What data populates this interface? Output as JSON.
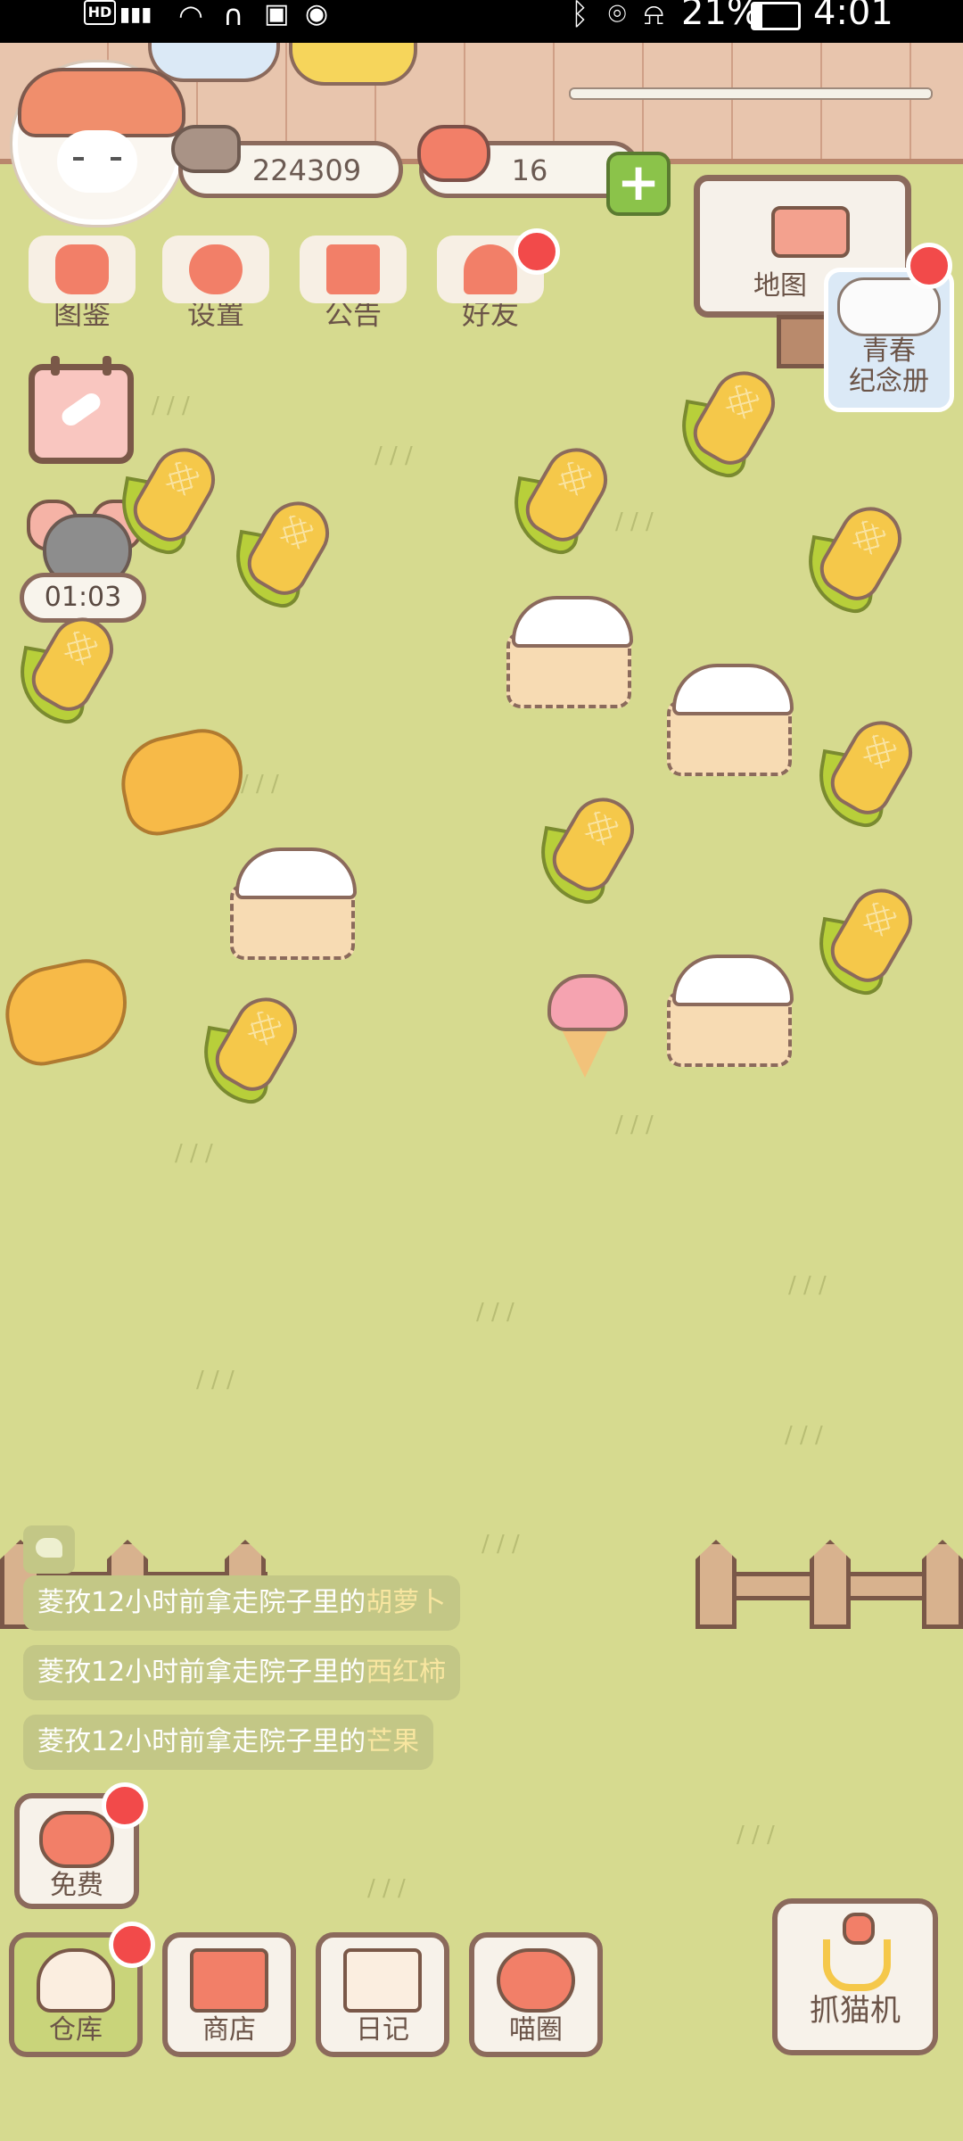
{
  "status_bar": {
    "network": "HD 4G",
    "battery": "21%",
    "time": "4:01",
    "icons": [
      "wifi-icon",
      "headphones-icon",
      "cast-icon",
      "location-icon",
      "bluetooth-icon",
      "mute-icon",
      "battery-icon"
    ]
  },
  "resources": {
    "fish": "224309",
    "hearts": "16"
  },
  "top_menu": [
    {
      "label": "图鉴",
      "icon": "cat-face-icon"
    },
    {
      "label": "设置",
      "icon": "gear-icon"
    },
    {
      "label": "公告",
      "icon": "gift-icon"
    },
    {
      "label": "好友",
      "icon": "friends-icon"
    }
  ],
  "map_label": "地图",
  "youth_book": {
    "line1": "青春",
    "line2": "纪念册"
  },
  "timer": "01:03",
  "chat": {
    "messages": [
      {
        "name": "菱孜",
        "text": "12小时前拿走院子里的",
        "item": "胡萝卜"
      },
      {
        "name": "菱孜",
        "text": "12小时前拿走院子里的",
        "item": "西红柿"
      },
      {
        "name": "菱孜",
        "text": "12小时前拿走院子里的",
        "item": "芒果"
      }
    ]
  },
  "free_label": "免费",
  "bottom_nav": [
    {
      "label": "仓库",
      "icon": "warehouse-icon"
    },
    {
      "label": "商店",
      "icon": "shop-icon"
    },
    {
      "label": "日记",
      "icon": "diary-icon"
    },
    {
      "label": "喵圈",
      "icon": "planet-cat-icon"
    }
  ],
  "claw_label": "抓猫机",
  "colors": {
    "grass": "#d6da8f",
    "accent": "#f27f68",
    "badge": "#f24a4a",
    "wood": "#8b6a5c"
  }
}
